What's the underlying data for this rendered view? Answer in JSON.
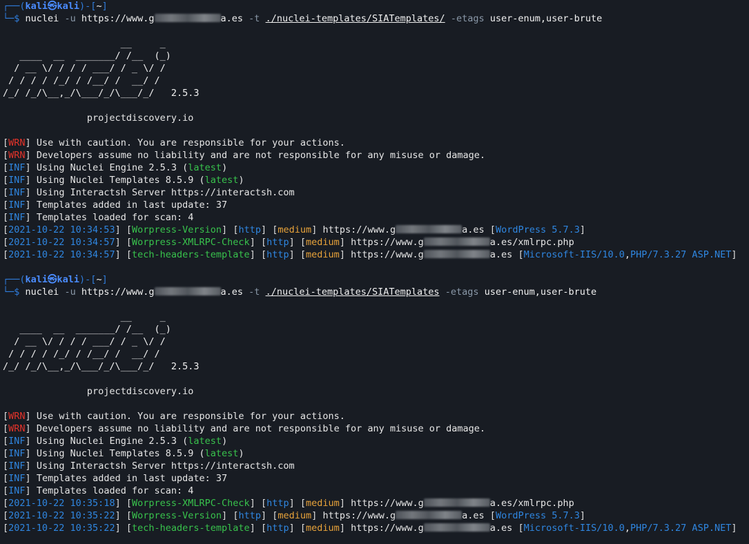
{
  "prompt": {
    "user": "kali",
    "host": "kali",
    "cwd": "~",
    "at": "㉿"
  },
  "runs": [
    {
      "cmd": {
        "bin": "nuclei",
        "u_flag": "-u",
        "url_prefix": "https://www.g",
        "url_suffix": "a.es",
        "t_flag": "-t",
        "template_path": "./nuclei-templates/SIATemplates/",
        "etags_flag": "-etags",
        "etags_value": "user-enum,user-brute"
      },
      "banner": [
        "                     __     _",
        "   ____  __  _______/ /__  (_)",
        "  / __ \\/ / / / ___/ / _ \\/ /",
        " / / / / /_/ / /__/ /  __/ /",
        "/_/ /_/\\__,_/\\___/_/\\___/_/   "
      ],
      "version": "2.5.3",
      "site": "projectdiscovery.io",
      "messages": [
        {
          "tag": "WRN",
          "text": "Use with caution. You are responsible for your actions."
        },
        {
          "tag": "WRN",
          "text": "Developers assume no liability and are not responsible for any misuse or damage."
        },
        {
          "tag": "INF",
          "text": "Using Nuclei Engine 2.5.3 ",
          "extra": "latest"
        },
        {
          "tag": "INF",
          "text": "Using Nuclei Templates 8.5.9 ",
          "extra": "latest"
        },
        {
          "tag": "INF",
          "text": "Using Interactsh Server https://interactsh.com"
        },
        {
          "tag": "INF",
          "text": "Templates added in last update: 37"
        },
        {
          "tag": "INF",
          "text": "Templates loaded for scan: 4"
        }
      ],
      "results": [
        {
          "ts": "2021-10-22 10:34:53",
          "tpl": "Worpress-Version",
          "proto": "http",
          "sev": "medium",
          "url_prefix": "https://www.g",
          "url_suffix": "a.es",
          "tech": [
            "WordPress 5.7.3"
          ]
        },
        {
          "ts": "2021-10-22 10:34:57",
          "tpl": "Worpress-XMLRPC-Check",
          "proto": "http",
          "sev": "medium",
          "url_prefix": "https://www.g",
          "url_suffix": "a.es/xmlrpc.php",
          "tech": []
        },
        {
          "ts": "2021-10-22 10:34:57",
          "tpl": "tech-headers-template",
          "proto": "http",
          "sev": "medium",
          "url_prefix": "https://www.g",
          "url_suffix": "a.es",
          "tech": [
            "Microsoft-IIS/10.0",
            "PHP/7.3.27 ASP.NET"
          ]
        }
      ]
    },
    {
      "cmd": {
        "bin": "nuclei",
        "u_flag": "-u",
        "url_prefix": "https://www.g",
        "url_suffix": "a.es",
        "t_flag": "-t",
        "template_path": "./nuclei-templates/SIATemplates",
        "etags_flag": "-etags",
        "etags_value": "user-enum,user-brute"
      },
      "banner": [
        "                     __     _",
        "   ____  __  _______/ /__  (_)",
        "  / __ \\/ / / / ___/ / _ \\/ /",
        " / / / / /_/ / /__/ /  __/ /",
        "/_/ /_/\\__,_/\\___/_/\\___/_/   "
      ],
      "version": "2.5.3",
      "site": "projectdiscovery.io",
      "messages": [
        {
          "tag": "WRN",
          "text": "Use with caution. You are responsible for your actions."
        },
        {
          "tag": "WRN",
          "text": "Developers assume no liability and are not responsible for any misuse or damage."
        },
        {
          "tag": "INF",
          "text": "Using Nuclei Engine 2.5.3 ",
          "extra": "latest"
        },
        {
          "tag": "INF",
          "text": "Using Nuclei Templates 8.5.9 ",
          "extra": "latest"
        },
        {
          "tag": "INF",
          "text": "Using Interactsh Server https://interactsh.com"
        },
        {
          "tag": "INF",
          "text": "Templates added in last update: 37"
        },
        {
          "tag": "INF",
          "text": "Templates loaded for scan: 4"
        }
      ],
      "results": [
        {
          "ts": "2021-10-22 10:35:18",
          "tpl": "Worpress-XMLRPC-Check",
          "proto": "http",
          "sev": "medium",
          "url_prefix": "https://www.g",
          "url_suffix": "a.es/xmlrpc.php",
          "tech": []
        },
        {
          "ts": "2021-10-22 10:35:22",
          "tpl": "Worpress-Version",
          "proto": "http",
          "sev": "medium",
          "url_prefix": "https://www.g",
          "url_suffix": "a.es",
          "tech": [
            "WordPress 5.7.3"
          ]
        },
        {
          "ts": "2021-10-22 10:35:22",
          "tpl": "tech-headers-template",
          "proto": "http",
          "sev": "medium",
          "url_prefix": "https://www.g",
          "url_suffix": "a.es",
          "tech": [
            "Microsoft-IIS/10.0",
            "PHP/7.3.27 ASP.NET"
          ]
        }
      ]
    }
  ]
}
